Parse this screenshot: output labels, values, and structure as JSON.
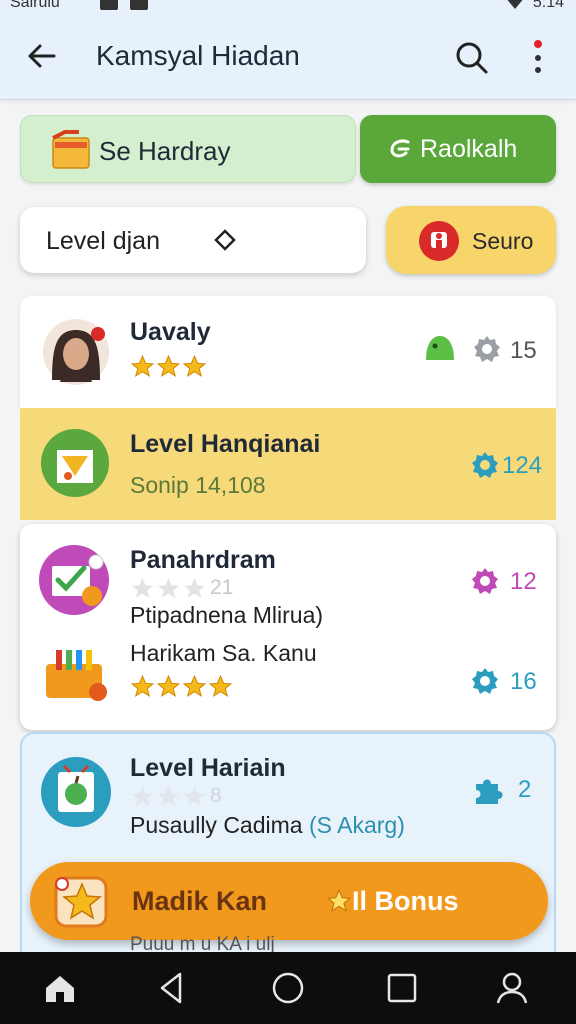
{
  "status_bar": {
    "carrier": "Sairuiu",
    "time": "5:14"
  },
  "app_bar": {
    "title": "Kamsyal Hiadan"
  },
  "actions": {
    "left_chip": "Se Hardray",
    "right_chip": "Raolkalh"
  },
  "filter": {
    "level_label": "Level djan",
    "yellow_chip": "Seuro"
  },
  "items": [
    {
      "name": "Uavaly",
      "rating": 3,
      "count": "15"
    },
    {
      "name": "Level Hanqianai",
      "subtitle": "Sonip 14,108",
      "count": "124"
    },
    {
      "name": "Panahrdram",
      "rating_text": "21",
      "subtitle": "Ptipadnena Mlirua)",
      "count": "12"
    },
    {
      "name": "Harikam Sa. Kanu",
      "rating": 4,
      "count": "16"
    },
    {
      "name": "Level Hariain",
      "rating_text": "8",
      "subtitle": "Pusaully Cadima",
      "subtitle_accent": "(S Akarg)",
      "count": "2"
    }
  ],
  "cta": {
    "label": "Madik Kan",
    "bonus": "Il Bonus"
  },
  "peek_text": "Puuu m u KA i ulj",
  "colors": {
    "accent_green": "#5aa83a",
    "accent_yellow": "#f7d56a",
    "accent_orange": "#f1991d",
    "teal": "#2b9ec0",
    "magenta": "#c04ab8"
  }
}
